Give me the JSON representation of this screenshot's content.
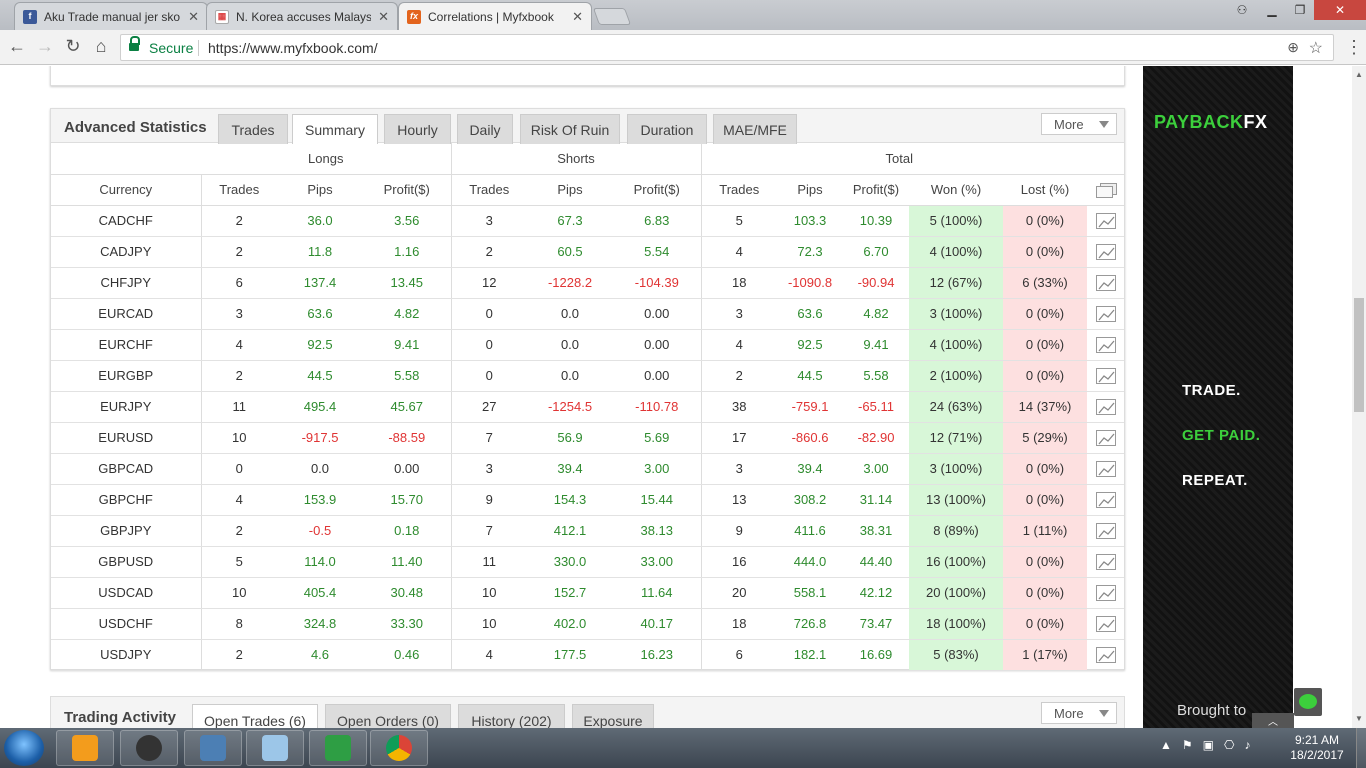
{
  "browser": {
    "tabs": [
      {
        "title": "Aku Trade manual jer sko",
        "favicon": "facebook-icon",
        "color": "#3b5998",
        "glyph": "f"
      },
      {
        "title": "N. Korea accuses Malays",
        "favicon": "news-icon",
        "color": "#d44",
        "glyph": "▦"
      },
      {
        "title": "Correlations | Myfxbook",
        "favicon": "myfxbook-icon",
        "color": "#e3641d",
        "glyph": "fx"
      }
    ],
    "security_label": "Secure",
    "url": "https://www.myfxbook.com/"
  },
  "advanced_statistics": {
    "title": "Advanced Statistics",
    "tabs": [
      "Trades",
      "Summary",
      "Hourly",
      "Daily",
      "Risk Of Ruin",
      "Duration",
      "MAE/MFE"
    ],
    "active_tab": "Summary",
    "more_label": "More",
    "groups": {
      "longs": "Longs",
      "shorts": "Shorts",
      "total": "Total"
    },
    "columns": [
      "Currency",
      "Trades",
      "Pips",
      "Profit($)",
      "Trades",
      "Pips",
      "Profit($)",
      "Trades",
      "Pips",
      "Profit($)",
      "Won (%)",
      "Lost (%)"
    ],
    "rows": [
      [
        "CADCHF",
        "2",
        "36.0",
        "3.56",
        "3",
        "67.3",
        "6.83",
        "5",
        "103.3",
        "10.39",
        "5 (100%)",
        "0 (0%)"
      ],
      [
        "CADJPY",
        "2",
        "11.8",
        "1.16",
        "2",
        "60.5",
        "5.54",
        "4",
        "72.3",
        "6.70",
        "4 (100%)",
        "0 (0%)"
      ],
      [
        "CHFJPY",
        "6",
        "137.4",
        "13.45",
        "12",
        "-1228.2",
        "-104.39",
        "18",
        "-1090.8",
        "-90.94",
        "12 (67%)",
        "6 (33%)"
      ],
      [
        "EURCAD",
        "3",
        "63.6",
        "4.82",
        "0",
        "0.0",
        "0.00",
        "3",
        "63.6",
        "4.82",
        "3 (100%)",
        "0 (0%)"
      ],
      [
        "EURCHF",
        "4",
        "92.5",
        "9.41",
        "0",
        "0.0",
        "0.00",
        "4",
        "92.5",
        "9.41",
        "4 (100%)",
        "0 (0%)"
      ],
      [
        "EURGBP",
        "2",
        "44.5",
        "5.58",
        "0",
        "0.0",
        "0.00",
        "2",
        "44.5",
        "5.58",
        "2 (100%)",
        "0 (0%)"
      ],
      [
        "EURJPY",
        "11",
        "495.4",
        "45.67",
        "27",
        "-1254.5",
        "-110.78",
        "38",
        "-759.1",
        "-65.11",
        "24 (63%)",
        "14 (37%)"
      ],
      [
        "EURUSD",
        "10",
        "-917.5",
        "-88.59",
        "7",
        "56.9",
        "5.69",
        "17",
        "-860.6",
        "-82.90",
        "12 (71%)",
        "5 (29%)"
      ],
      [
        "GBPCAD",
        "0",
        "0.0",
        "0.00",
        "3",
        "39.4",
        "3.00",
        "3",
        "39.4",
        "3.00",
        "3 (100%)",
        "0 (0%)"
      ],
      [
        "GBPCHF",
        "4",
        "153.9",
        "15.70",
        "9",
        "154.3",
        "15.44",
        "13",
        "308.2",
        "31.14",
        "13 (100%)",
        "0 (0%)"
      ],
      [
        "GBPJPY",
        "2",
        "-0.5",
        "0.18",
        "7",
        "412.1",
        "38.13",
        "9",
        "411.6",
        "38.31",
        "8 (89%)",
        "1 (11%)"
      ],
      [
        "GBPUSD",
        "5",
        "114.0",
        "11.40",
        "11",
        "330.0",
        "33.00",
        "16",
        "444.0",
        "44.40",
        "16 (100%)",
        "0 (0%)"
      ],
      [
        "USDCAD",
        "10",
        "405.4",
        "30.48",
        "10",
        "152.7",
        "11.64",
        "20",
        "558.1",
        "42.12",
        "20 (100%)",
        "0 (0%)"
      ],
      [
        "USDCHF",
        "8",
        "324.8",
        "33.30",
        "10",
        "402.0",
        "40.17",
        "18",
        "726.8",
        "73.47",
        "18 (100%)",
        "0 (0%)"
      ],
      [
        "USDJPY",
        "2",
        "4.6",
        "0.46",
        "4",
        "177.5",
        "16.23",
        "6",
        "182.1",
        "16.69",
        "5 (83%)",
        "1 (17%)"
      ]
    ]
  },
  "trading_activity": {
    "title": "Trading Activity",
    "tabs": [
      "Open Trades (6)",
      "Open Orders (0)",
      "History (202)",
      "Exposure"
    ],
    "active_tab": "Open Trades (6)",
    "more_label": "More"
  },
  "ad": {
    "logo_a": "PAYBACK",
    "logo_b": "FX",
    "line1": "TRADE.",
    "line2": "GET PAID.",
    "line3": "REPEAT.",
    "footer": "Brought to",
    "accent": "#3ccf3c"
  },
  "taskbar": {
    "time": "9:21 AM",
    "date": "18/2/2017",
    "apps": [
      "media-player-icon",
      "webcam-icon",
      "computer-icon",
      "mocaz-icon",
      "forex-app-icon",
      "chrome-icon"
    ]
  }
}
